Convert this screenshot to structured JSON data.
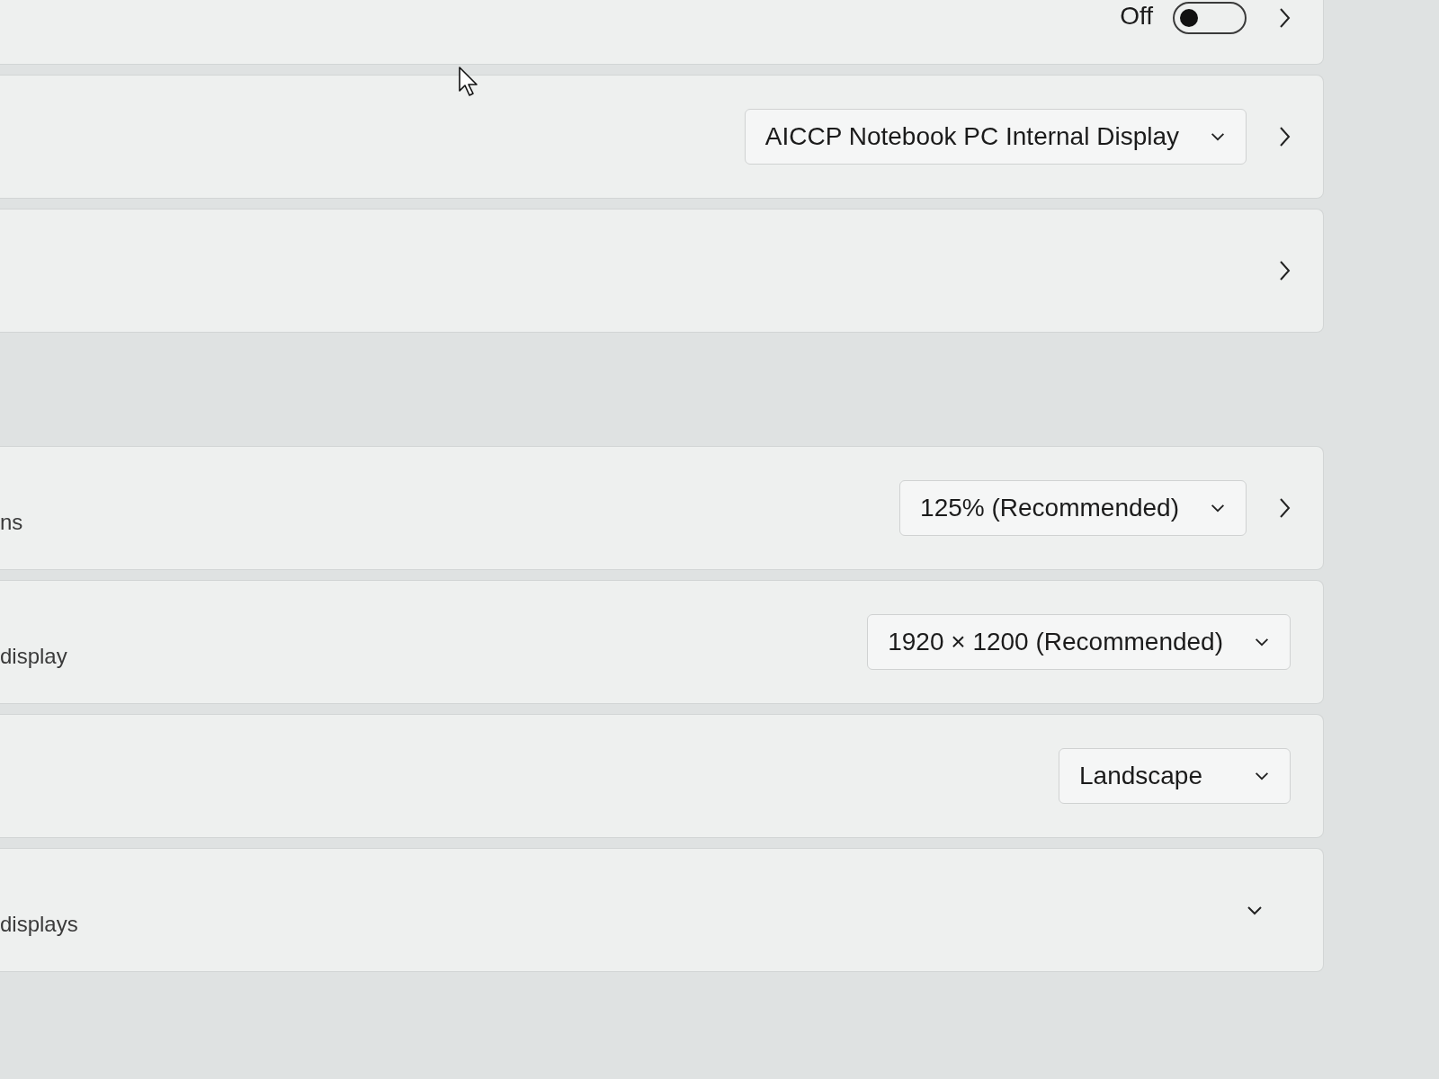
{
  "sections": [
    {
      "rows": [
        {
          "kind": "toggle",
          "state_text": "Off",
          "on": false
        },
        {
          "kind": "dropdown_link",
          "value": "AICCP Notebook PC Internal Display"
        },
        {
          "kind": "link"
        }
      ]
    },
    {
      "rows": [
        {
          "kind": "dropdown_link",
          "label": "ns",
          "value": "125% (Recommended)"
        },
        {
          "kind": "dropdown",
          "label": "display",
          "value": "1920 × 1200 (Recommended)"
        },
        {
          "kind": "dropdown",
          "value": "Landscape"
        },
        {
          "kind": "expander",
          "label": "displays",
          "expanded": false
        }
      ]
    }
  ]
}
